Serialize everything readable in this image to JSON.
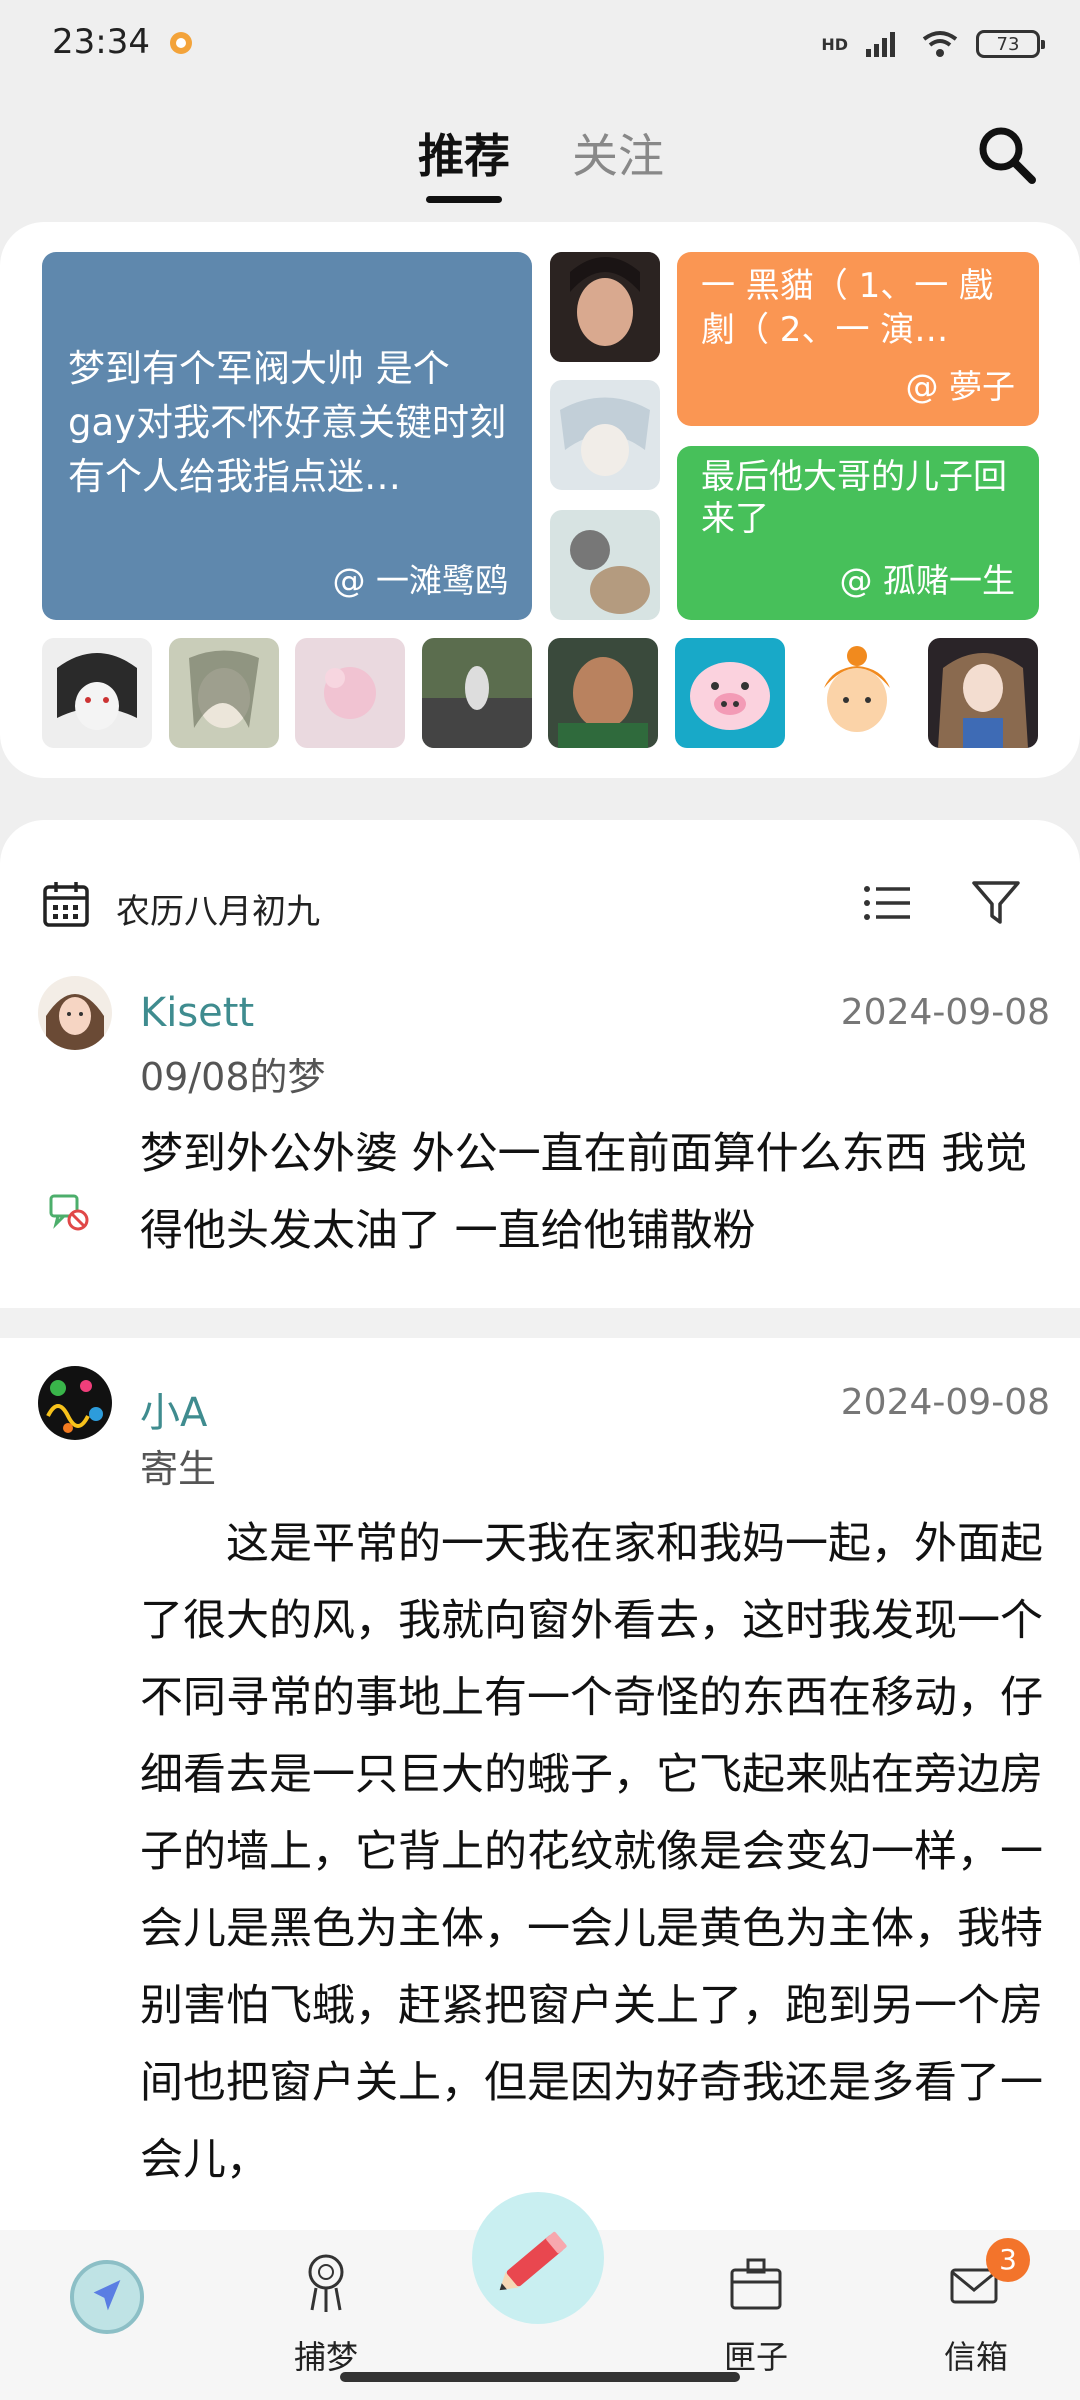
{
  "status_bar": {
    "time": "23:34",
    "network": "HD",
    "battery": "73"
  },
  "top_tabs": {
    "recommended": "推荐",
    "following": "关注"
  },
  "featured": {
    "tiles": [
      {
        "text": "梦到有个军阀大帅 是个gay对我不怀好意关键时刻有个人给我指点迷…",
        "author": "@ 一滩鹭鸥",
        "color": "#5f88ad"
      },
      {
        "text": "一 黑貓（ 1、一 戲劇（ 2、一 演…",
        "author": "@ 夢子",
        "color": "#fa9653"
      },
      {
        "text": "最后他大哥的儿子回来了",
        "author": "@ 孤赌一生",
        "color": "#47c05a"
      }
    ]
  },
  "filter": {
    "date_label": "农历八月初九"
  },
  "posts": [
    {
      "user": "Kisett",
      "date": "2024-09-08",
      "title": "09/08的梦",
      "body": "梦到外公外婆 外公一直在前面算什么东西 我觉得他头发太油了 一直给他铺散粉"
    },
    {
      "user": "小A",
      "date": "2024-09-08",
      "title": "寄生",
      "body": "　　这是平常的一天我在家和我妈一起，外面起了很大的风，我就向窗外看去，这时我发现一个不同寻常的事地上有一个奇怪的东西在移动，仔细看去是一只巨大的蛾子，它飞起来贴在旁边房子的墙上，它背上的花纹就像是会变幻一样，一会儿是黑色为主体，一会儿是黄色为主体，我特别害怕飞蛾，赶紧把窗户关上了，跑到另一个房间也把窗户关上，但是因为好奇我还是多看了一会儿，"
    }
  ],
  "bottom_nav": {
    "catch_dream": "捕梦",
    "box": "匣子",
    "mailbox": "信箱",
    "mailbox_badge": "3"
  },
  "colors": {
    "accent_teal": "#3f8c8f",
    "badge_orange": "#f3742b"
  }
}
